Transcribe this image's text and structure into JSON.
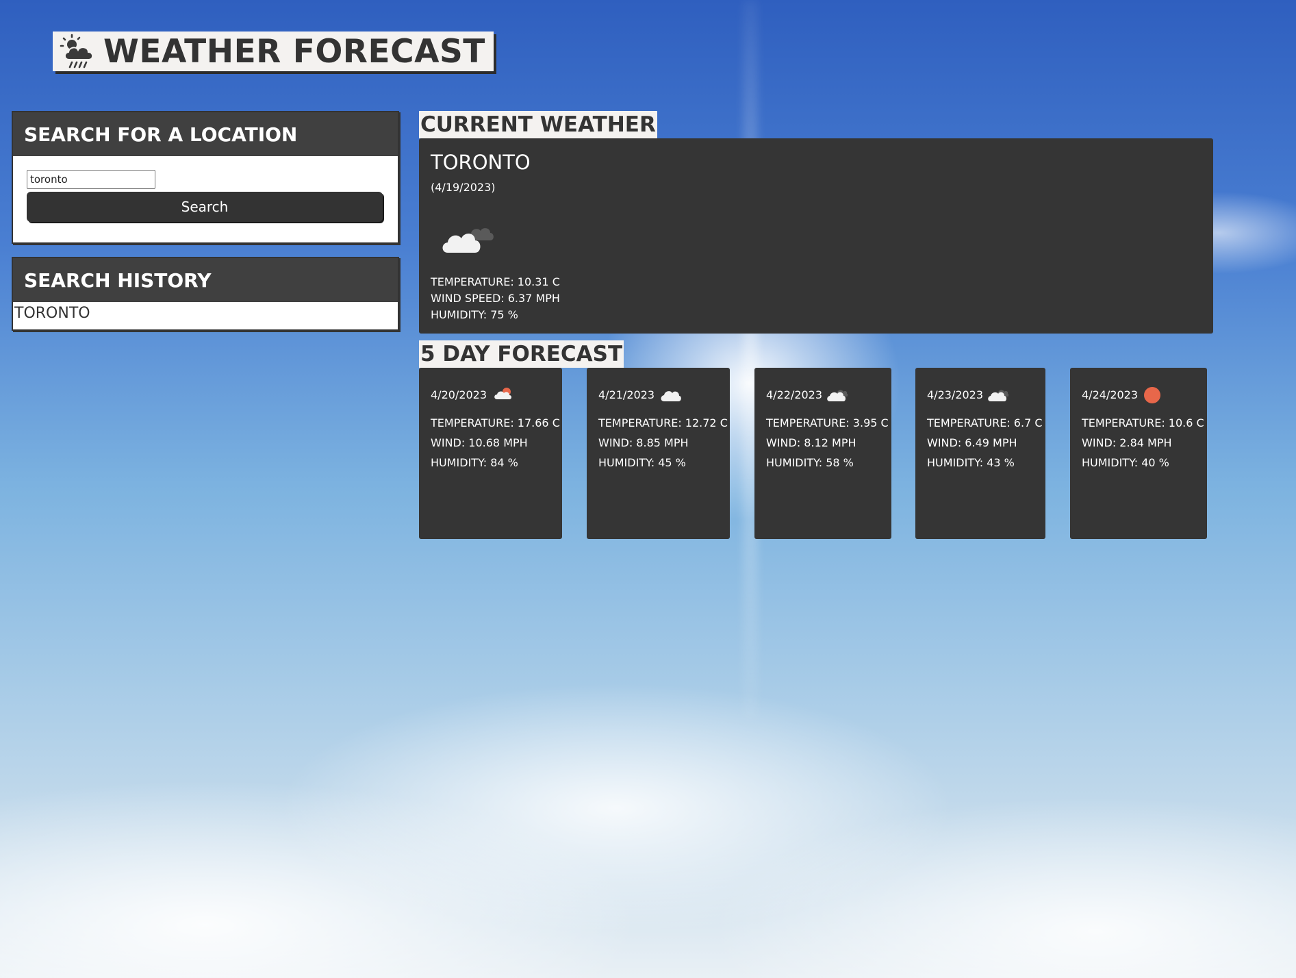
{
  "app": {
    "title": "WEATHER FORECAST",
    "logo_icon": "sun-cloud-rain-icon"
  },
  "search": {
    "heading": "SEARCH FOR A LOCATION",
    "input_value": "toronto",
    "button_label": "Search"
  },
  "history": {
    "heading": "SEARCH HISTORY",
    "items": [
      "TORONTO"
    ]
  },
  "current": {
    "heading": "CURRENT WEATHER",
    "city": "TORONTO",
    "date": "(4/19/2023)",
    "icon": "broken-clouds-icon",
    "temperature": "TEMPERATURE: 10.31 C",
    "wind": "WIND SPEED: 6.37 MPH",
    "humidity": "HUMIDITY: 75 %"
  },
  "forecast": {
    "heading": "5 DAY FORECAST",
    "days": [
      {
        "date": "4/20/2023",
        "icon": "few-clouds-day-icon",
        "temperature": "TEMPERATURE: 17.66 C",
        "wind": "WIND: 10.68 MPH",
        "humidity": "HUMIDITY: 84 %"
      },
      {
        "date": "4/21/2023",
        "icon": "cloud-icon",
        "temperature": "TEMPERATURE: 12.72 C",
        "wind": "WIND: 8.85 MPH",
        "humidity": "HUMIDITY: 45 %"
      },
      {
        "date": "4/22/2023",
        "icon": "broken-clouds-icon",
        "temperature": "TEMPERATURE: 3.95 C",
        "wind": "WIND: 8.12 MPH",
        "humidity": "HUMIDITY: 58 %"
      },
      {
        "date": "4/23/2023",
        "icon": "broken-clouds-icon",
        "temperature": "TEMPERATURE: 6.7 C",
        "wind": "WIND: 6.49 MPH",
        "humidity": "HUMIDITY: 43 %"
      },
      {
        "date": "4/24/2023",
        "icon": "clear-sun-icon",
        "temperature": "TEMPERATURE: 10.6 C",
        "wind": "WIND: 2.84 MPH",
        "humidity": "HUMIDITY: 40 %"
      }
    ]
  },
  "colors": {
    "panel": "#353535",
    "header": "#404040",
    "label_bg": "#f4f2f0",
    "sun": "#e8674a",
    "cloud": "#f2f2f2"
  }
}
